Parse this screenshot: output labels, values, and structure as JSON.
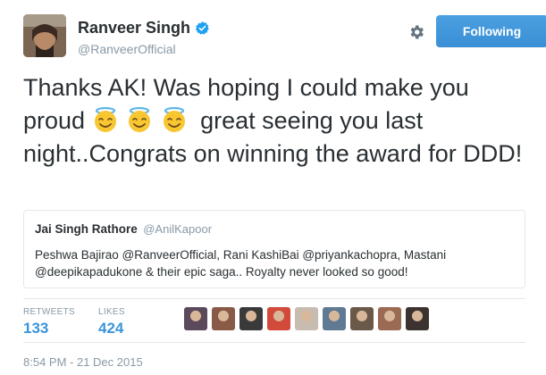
{
  "author": {
    "display_name": "Ranveer Singh",
    "handle": "@RanveerOfficial",
    "verified": true
  },
  "actions": {
    "follow_label": "Following"
  },
  "tweet": {
    "text_part1": "Thanks AK! Was hoping I could make you proud",
    "text_part2": "great seeing you last night..Congrats on winning the award for DDD!",
    "emojis": [
      "smiling-face-with-halo",
      "smiling-face-with-halo",
      "smiling-face-with-halo"
    ]
  },
  "quoted_tweet": {
    "display_name": "Jai Singh Rathore",
    "handle": "@AnilKapoor",
    "text": "Peshwa Bajirao @RanveerOfficial, Rani KashiBai @priyankachopra, Mastani @deepikapadukone & their epic saga.. Royalty never looked so good!"
  },
  "stats": {
    "retweets_label": "RETWEETS",
    "retweets_count": "133",
    "likes_label": "LIKES",
    "likes_count": "424"
  },
  "liker_avatars": [
    "#5a4a5c",
    "#8a5a48",
    "#3a3a3a",
    "#d14a3a",
    "#c8bcb0",
    "#5f7a92",
    "#6a5848",
    "#9a6a52",
    "#3c3230"
  ],
  "timestamp": "8:54 PM - 21 Dec 2015",
  "colors": {
    "accent": "#3b94d9",
    "muted": "#8899a6",
    "text": "#292f33"
  }
}
